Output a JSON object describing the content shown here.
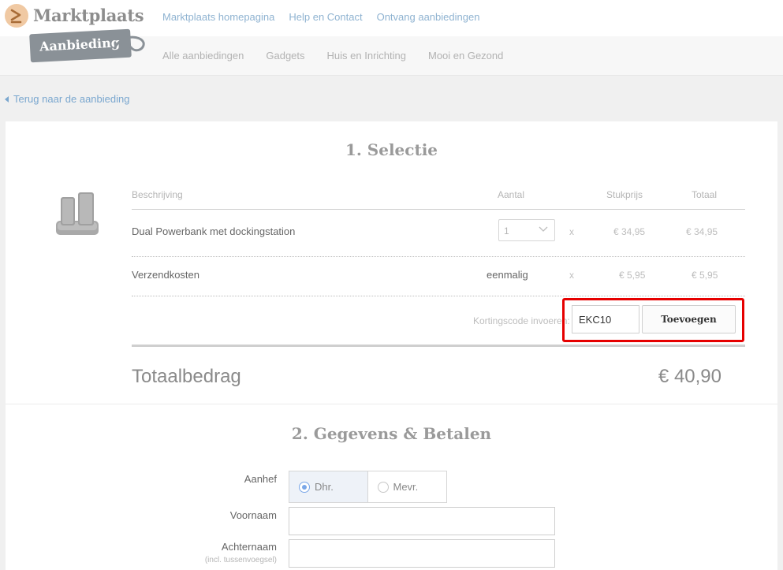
{
  "header": {
    "logo_text": "Marktplaats",
    "tag_label": "Aanbieding",
    "top_nav": [
      "Marktplaats homepagina",
      "Help en Contact",
      "Ontvang aanbiedingen"
    ],
    "sub_nav": [
      "Alle aanbiedingen",
      "Gadgets",
      "Huis en Inrichting",
      "Mooi en Gezond"
    ]
  },
  "back_link": "Terug naar de aanbieding",
  "selection": {
    "title": "1. Selectie",
    "columns": {
      "description": "Beschrijving",
      "quantity": "Aantal",
      "unit_price": "Stukprijs",
      "total": "Totaal"
    },
    "rows": [
      {
        "description": "Dual Powerbank met dockingstation",
        "quantity": "1",
        "times": "x",
        "unit_price": "€ 34,95",
        "total": "€ 34,95"
      },
      {
        "description": "Verzendkosten",
        "quantity": "eenmalig",
        "times": "x",
        "unit_price": "€ 5,95",
        "total": "€ 5,95"
      }
    ],
    "discount": {
      "label": "Kortingscode invoeren:",
      "code_value": "EKC10",
      "button_label": "Toevoegen"
    },
    "total_label": "Totaalbedrag",
    "total_value": "€ 40,90"
  },
  "details": {
    "title": "2. Gegevens & Betalen",
    "salutation_label": "Aanhef",
    "salutation_options": [
      "Dhr.",
      "Mevr."
    ],
    "salutation_selected": "Dhr.",
    "first_name_label": "Voornaam",
    "first_name_value": "",
    "last_name_label": "Achternaam",
    "last_name_sub": "(incl. tussenvoegsel)",
    "last_name_value": ""
  },
  "colors": {
    "link": "#8fb3d1",
    "highlight": "#e60000",
    "radio_accent": "#7aa7e8"
  }
}
